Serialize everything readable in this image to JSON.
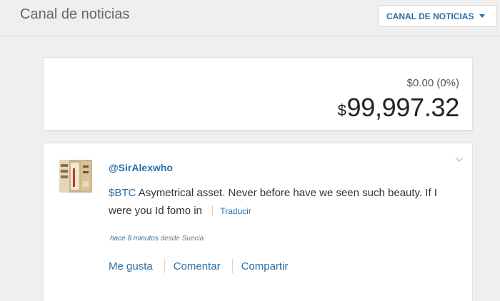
{
  "header": {
    "title": "Canal de noticias",
    "feed_selector_label": "CANAL DE NOTICIAS"
  },
  "price_card": {
    "change": "$0.00 (0%)",
    "currency_symbol": "$",
    "price": "99,997.32"
  },
  "post": {
    "author": "@SirAlexwho",
    "cashtag": "$BTC",
    "text": " Asymetrical asset. Never before have we seen such beauty. If I were you Id fomo in",
    "translate_label": "Traducir",
    "time": "hace 8 minutos",
    "location": " desde Suecia",
    "actions": {
      "like": "Me gusta",
      "comment": "Comentar",
      "share": "Compartir"
    }
  },
  "colors": {
    "accent": "#2a6fa8",
    "background": "#efefef",
    "card": "#ffffff"
  },
  "icons": [
    "chevron-down-icon",
    "avatar"
  ]
}
